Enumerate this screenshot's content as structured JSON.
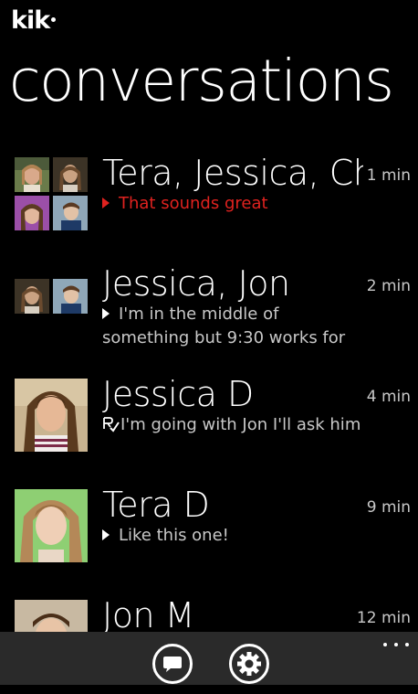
{
  "app": {
    "logo_text": "kik"
  },
  "page": {
    "title": "conversations"
  },
  "conversations": [
    {
      "name": "Tera, Jessica, Chl",
      "time": "1 min",
      "preview": "That sounds great",
      "unread": true,
      "avatar_layout": "grid4"
    },
    {
      "name": "Jessica, Jon",
      "time": "2 min",
      "preview_line1": "I'm in the middle of",
      "preview_line2": "something but 9:30 works for",
      "avatar_layout": "pair"
    },
    {
      "name": "Jessica D",
      "time": "4 min",
      "preview": "I'm going with Jon I'll ask him",
      "status_icon": "read-receipt-icon",
      "avatar_layout": "single"
    },
    {
      "name": "Tera D",
      "time": "9 min",
      "preview": "Like this one!",
      "avatar_layout": "single"
    },
    {
      "name": "Jon M",
      "time": "12 min",
      "avatar_layout": "single"
    }
  ],
  "appbar": {
    "buttons": [
      {
        "icon": "new-chat-icon"
      },
      {
        "icon": "settings-gear-icon"
      }
    ],
    "more_icon": "ellipsis-icon"
  },
  "colors": {
    "background": "#000000",
    "unread": "#e0221f",
    "secondary_text": "#c8c8c8",
    "appbar": "#2a2a2a"
  }
}
